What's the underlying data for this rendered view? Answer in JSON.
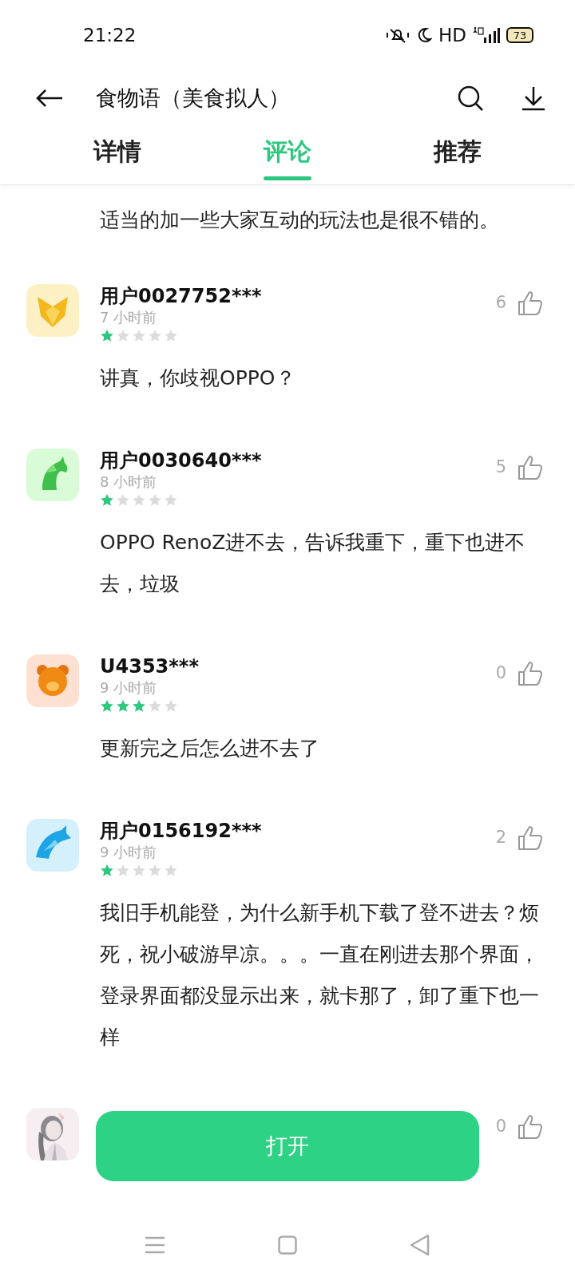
{
  "status_bar": {
    "time": "21:22",
    "network": "HD",
    "battery": "73"
  },
  "header": {
    "title": "食物语（美食拟人）"
  },
  "tabs": [
    {
      "label": "详情",
      "selected": false
    },
    {
      "label": "评论",
      "selected": true
    },
    {
      "label": "推荐",
      "selected": false
    }
  ],
  "partial_comment": {
    "text": "适当的加一些大家互动的玩法也是很不错的。"
  },
  "comments": [
    {
      "kind": "fox",
      "user": "用户0027752***",
      "time": "7 小时前",
      "stars": 1,
      "likes": "6",
      "text": "讲真，你歧视OPPO？"
    },
    {
      "kind": "horse",
      "user": "用户0030640***",
      "time": "8 小时前",
      "stars": 1,
      "likes": "5",
      "text": "OPPO RenoZ进不去，告诉我重下，重下也进不去，垃圾"
    },
    {
      "kind": "bear",
      "user": "U4353***",
      "time": "9 小时前",
      "stars": 3,
      "likes": "0",
      "text": "更新完之后怎么进不去了"
    },
    {
      "kind": "wolf",
      "user": "用户0156192***",
      "time": "9 小时前",
      "stars": 1,
      "likes": "2",
      "text": "我旧手机能登，为什么新手机下载了登不进去？烦死，祝小破游早凉。。。一直在刚进去那个界面，登录界面都没显示出来，就卡那了，卸了重下也一样"
    },
    {
      "kind": "picture",
      "likes": "0"
    }
  ],
  "open_button": {
    "label": "打开"
  }
}
